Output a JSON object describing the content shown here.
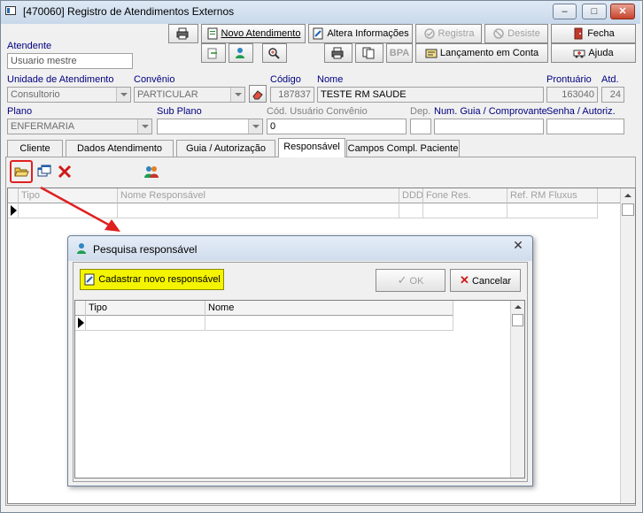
{
  "window": {
    "title": "[470060]  Registro de Atendimentos Externos",
    "minimize_label": "–",
    "maximize_label": "□",
    "close_label": "✕"
  },
  "toolbar": {
    "novo_atendimento": "Novo Atendimento",
    "altera_informacoes": "Altera Informações",
    "registra": "Registra",
    "desiste": "Desiste",
    "fecha": "Fecha",
    "bpa": "BPA",
    "lancamento_em_conta": "Lançamento em Conta",
    "ajuda": "Ajuda"
  },
  "form": {
    "atendente_label": "Atendente",
    "atendente_value": "Usuario mestre",
    "unidade_label": "Unidade de Atendimento",
    "unidade_value": "Consultorio",
    "convenio_label": "Convênio",
    "convenio_value": "PARTICULAR",
    "codigo_label": "Código",
    "codigo_value": "187837",
    "nome_label": "Nome",
    "nome_value": "TESTE RM SAUDE",
    "prontuario_label": "Prontuário",
    "prontuario_value": "163040",
    "atd_label": "Atd.",
    "atd_value": "24",
    "plano_label": "Plano",
    "plano_value": "ENFERMARIA",
    "subplano_label": "Sub Plano",
    "subplano_value": "",
    "cod_usuario_label": "Cód. Usuário Convênio",
    "cod_usuario_value": "0",
    "dep_label": "Dep.",
    "num_guia_label": "Num. Guia / Comprovante",
    "senha_label": "Senha / Autoriz."
  },
  "tabs": [
    "Cliente",
    "Dados Atendimento",
    "Guia / Autorização",
    "Responsável",
    "Campos Compl. Paciente"
  ],
  "responsavel_grid": {
    "columns": [
      "Tipo",
      "Nome Responsável",
      "DDD",
      "Fone Res.",
      "Ref. RM Fluxus"
    ]
  },
  "dialog": {
    "title": "Pesquisa responsável",
    "cadastrar": "Cadastrar novo responsável",
    "ok": "OK",
    "cancelar": "Cancelar",
    "columns": [
      "Tipo",
      "Nome"
    ]
  },
  "colors": {
    "highlight_border": "#e02020",
    "arrow": "#e02020",
    "yellow_button": "#f4f400"
  }
}
